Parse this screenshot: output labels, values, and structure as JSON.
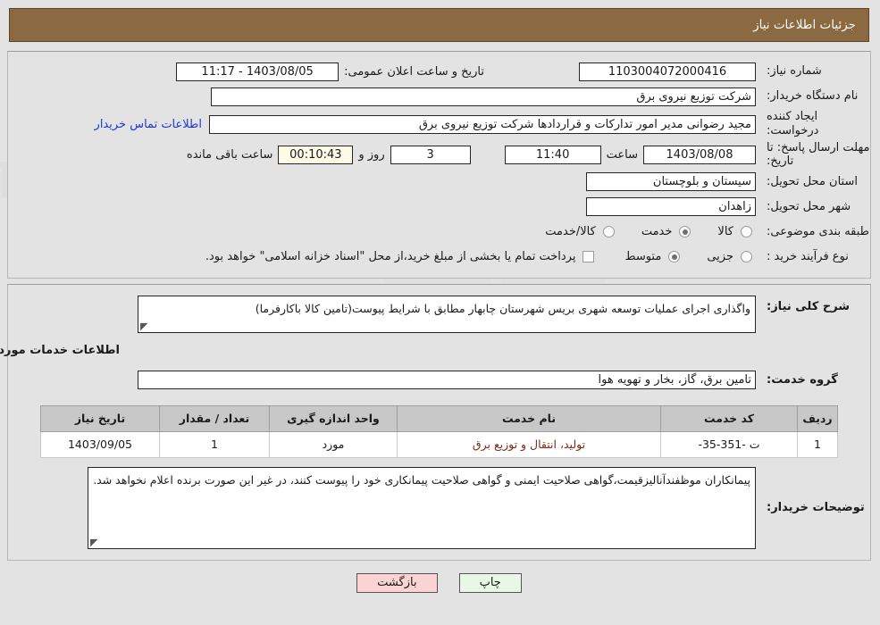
{
  "header": {
    "title": "جزئیات اطلاعات نیاز"
  },
  "fields": {
    "need_number_label": "شماره نیاز:",
    "need_number_value": "1103004072000416",
    "public_announce_label": "تاریخ و ساعت اعلان عمومی:",
    "public_announce_value": "1403/08/05 - 11:17",
    "buyer_org_label": "نام دستگاه خریدار:",
    "buyer_org_value": "شرکت توزیع نیروی برق",
    "creator_label": "ایجاد کننده درخواست:",
    "creator_value": "مجید  رضوانی مدیر امور تدارکات و قراردادها شرکت توزیع نیروی برق",
    "contact_link": "اطلاعات تماس خریدار",
    "deadline_label": "مهلت ارسال پاسخ: تا تاریخ:",
    "deadline_date": "1403/08/08",
    "deadline_hour_label": "ساعت",
    "deadline_hour": "11:40",
    "remaining_days": "3",
    "remaining_days_label": "روز و",
    "remaining_time": "00:10:43",
    "remaining_time_label": "ساعت باقی مانده",
    "province_label": "استان محل تحویل:",
    "province_value": "سیستان و بلوچستان",
    "city_label": "شهر محل تحویل:",
    "city_value": "زاهدان",
    "category_label": "طبقه بندی موضوعی:",
    "category_options": [
      {
        "label": "کالا",
        "selected": false
      },
      {
        "label": "خدمت",
        "selected": true
      },
      {
        "label": "کالا/خدمت",
        "selected": false
      }
    ],
    "process_label": "نوع فرآیند خرید :",
    "process_options": [
      {
        "label": "جزیی",
        "selected": false
      },
      {
        "label": "متوسط",
        "selected": true
      }
    ],
    "treasury_checkbox_label": "پرداخت تمام یا بخشی از مبلغ خرید،از محل \"اسناد خزانه اسلامی\" خواهد بود.",
    "treasury_checked": false
  },
  "description": {
    "label": "شرح کلی نیاز:",
    "value": "واگذاری اجرای عملیات توسعه شهری بریس شهرستان چابهار مطابق با شرایط پیوست(تامین کالا باکارفرما)"
  },
  "services": {
    "section_title": "اطلاعات خدمات مورد نیاز",
    "group_label": "گروه خدمت:",
    "group_value": "تامین برق، گاز، بخار و تهویه هوا",
    "table": {
      "columns": [
        "ردیف",
        "کد خدمت",
        "نام خدمت",
        "واحد اندازه گیری",
        "تعداد / مقدار",
        "تاریخ نیاز"
      ],
      "rows": [
        {
          "row_no": "1",
          "service_code": "ت -351-35-",
          "service_name": "تولید، انتقال و توزیع برق",
          "unit": "مورد",
          "quantity": "1",
          "need_date": "1403/09/05"
        }
      ]
    }
  },
  "buyer_notes": {
    "label": "توضیحات خریدار:",
    "value": "پیمانکاران موظفندآنالیزقیمت،گواهی صلاحیت ایمنی و گواهی صلاحیت پیمانکاری خود را پیوست کنند، در غیر این صورت برنده اعلام نخواهد شد."
  },
  "buttons": {
    "print": "چاپ",
    "back": "بازگشت"
  },
  "watermark": {
    "text": "AriaTender.net"
  },
  "colors": {
    "header_bg": "#8b6a42",
    "link": "#1a39d8",
    "table_header_bg": "#c8c8c8",
    "table_text": "#7a2b17",
    "print_btn": "#e9f7e6",
    "back_btn": "#fbd3d3",
    "timer_bg": "#fbfbe6"
  }
}
